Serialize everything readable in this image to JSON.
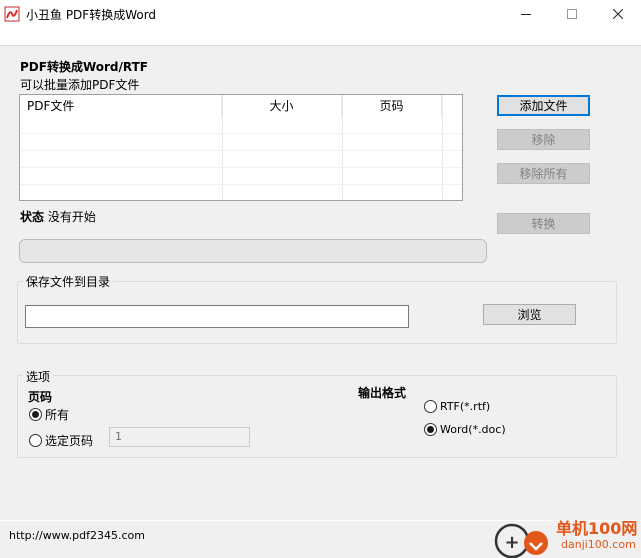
{
  "window": {
    "title": "小丑鱼 PDF转换成Word",
    "icon": "pdf-app-icon",
    "controls": [
      "minimize-icon",
      "maximize-icon",
      "close-icon"
    ]
  },
  "heading": "PDF转换成Word/RTF",
  "subheading": "可以批量添加PDF文件",
  "file_list": {
    "columns": [
      "PDF文件",
      "大小",
      "页码"
    ],
    "rows": []
  },
  "buttons": {
    "add_file": "添加文件",
    "remove": "移除",
    "remove_all": "移除所有",
    "convert": "转换",
    "browse": "浏览"
  },
  "status": {
    "label": "状态",
    "value": "没有开始",
    "progress": 0
  },
  "save_dir": {
    "group_label": "保存文件到目录",
    "path": ""
  },
  "options": {
    "group_label": "选项",
    "pages_label": "页码",
    "all_pages": "所有",
    "selected_pages": "选定页码",
    "selected_pages_value": "1",
    "pages_mode": "all",
    "output_format_label": "输出格式",
    "rtf": "RTF(*.rtf)",
    "word": "Word(*.doc)",
    "format": "word"
  },
  "footer": {
    "url": "http://www.pdf2345.com"
  },
  "watermark": {
    "text": "单机100网",
    "sub": "danji100.com",
    "color": "#e2571b"
  }
}
